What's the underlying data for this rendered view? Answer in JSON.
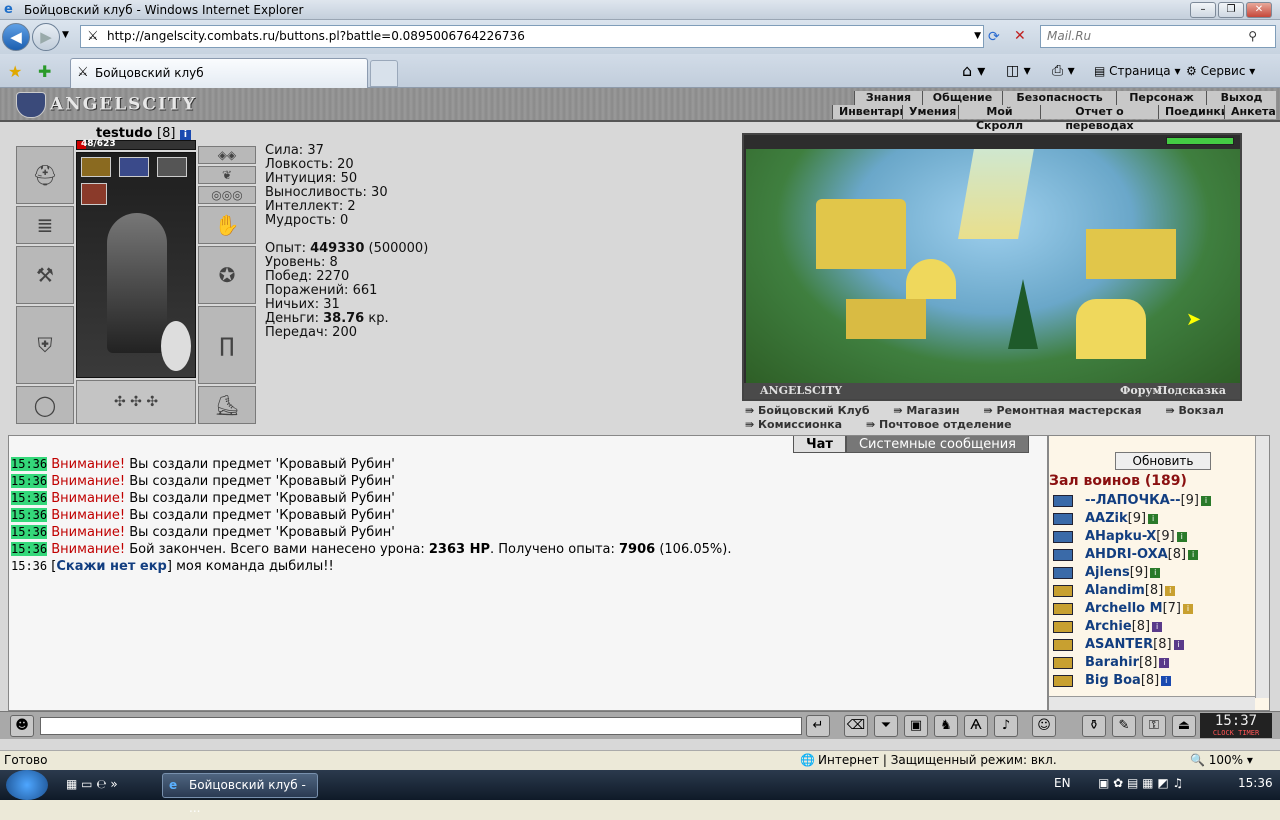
{
  "window": {
    "title": "Бойцовский клуб - Windows Internet Explorer"
  },
  "nav": {
    "url": "http://angelscity.combats.ru/buttons.pl?battle=0.0895006764226736",
    "search_placeholder": "Mail.Ru"
  },
  "tab": {
    "label": "Бойцовский клуб"
  },
  "toolbar": {
    "page": "Страница",
    "service": "Сервис"
  },
  "game": {
    "logo": "ANGELSCITY",
    "menu_top": [
      "Знания",
      "Общение",
      "Безопасность",
      "Персонаж",
      "Выход"
    ],
    "menu_bottom": [
      "Инвентарь",
      "Умения",
      "Мой Скролл",
      "Отчет о переводах",
      "Поединки",
      "Анкета"
    ],
    "character": {
      "name": "testudo",
      "level": "[8]",
      "hp": "48/623"
    },
    "stats": {
      "strength": "Сила: 37",
      "agility": "Ловкость: 20",
      "intuition": "Интуиция: 50",
      "stamina": "Выносливость: 30",
      "intellect": "Интеллект: 2",
      "wisdom": "Мудрость: 0",
      "exp_label": "Опыт: ",
      "exp_value": "449330",
      "exp_next": " (500000)",
      "level": "Уровень: 8",
      "wins": "Побед: 2270",
      "losses": "Поражений: 661",
      "draws": "Ничьих: 31",
      "money_label": "Деньги: ",
      "money_value": "38.76",
      "money_unit": " кр.",
      "transfers": "Передач: 200"
    },
    "city": {
      "name": "ANGELSCITY",
      "forum": "Форум",
      "hint": "Подсказка"
    },
    "links": [
      "Бойцовский Клуб",
      "Магазин",
      "Ремонтная мастерская",
      "Вокзал",
      "Комиссионка",
      "Почтовое отделение"
    ]
  },
  "chat": {
    "tabs": [
      "Чат",
      "Системные сообщения"
    ],
    "messages": [
      {
        "time": "15:36",
        "prefix": "Внимание!",
        "text": " Вы создали предмет 'Кровавый Рубин'"
      },
      {
        "time": "15:36",
        "prefix": "Внимание!",
        "text": " Вы создали предмет 'Кровавый Рубин'"
      },
      {
        "time": "15:36",
        "prefix": "Внимание!",
        "text": " Вы создали предмет 'Кровавый Рубин'"
      },
      {
        "time": "15:36",
        "prefix": "Внимание!",
        "text": " Вы создали предмет 'Кровавый Рубин'"
      },
      {
        "time": "15:36",
        "prefix": "Внимание!",
        "text": " Вы создали предмет 'Кровавый Рубин'"
      }
    ],
    "battle": {
      "time": "15:36",
      "prefix": "Внимание!",
      "t1": " Бой закончен. Всего вами нанесено урона: ",
      "dmg": "2363 HP",
      "t2": ". Получено опыта: ",
      "exp": "7906",
      "t3": " (106.05%)."
    },
    "user": {
      "time": "15:36",
      "who": "Скажи нет екр",
      "text": " моя команда дыбилы!!"
    }
  },
  "roster": {
    "refresh": "Обновить",
    "hall": "Зал воинов (189)",
    "players": [
      {
        "name": "--ЛАПОЧКА--",
        "level": "[9]"
      },
      {
        "name": "AAZik",
        "level": "[9]"
      },
      {
        "name": "AHapku-X",
        "level": "[9]"
      },
      {
        "name": "AHDRI-OXA",
        "level": "[8]"
      },
      {
        "name": "Ajlens",
        "level": "[9]"
      },
      {
        "name": "Alandim",
        "level": "[8]"
      },
      {
        "name": "Archello M",
        "level": "[7]"
      },
      {
        "name": "Archie",
        "level": "[8]"
      },
      {
        "name": "ASANTER",
        "level": "[8]"
      },
      {
        "name": "Barahir",
        "level": "[8]"
      },
      {
        "name": "Big Boa",
        "level": "[8]"
      }
    ]
  },
  "clock": {
    "time": "15:37",
    "clock_label": "CLOCK",
    "timer_label": "TIMER"
  },
  "status": {
    "ready": "Готово",
    "zone": "Интернет | Защищенный режим: вкл.",
    "zoom": "100%"
  },
  "taskbar": {
    "task": "Бойцовский клуб - ...",
    "lang": "EN",
    "time": "15:36"
  }
}
